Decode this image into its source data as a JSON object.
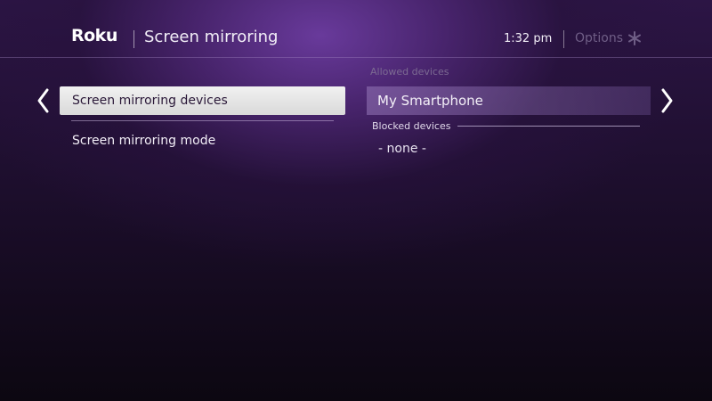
{
  "header": {
    "logo": "Roku",
    "title": "Screen mirroring",
    "time": "1:32  pm",
    "options_label": "Options",
    "options_icon": "asterisk-icon"
  },
  "nav": {
    "left_icon": "chevron-left-icon",
    "right_icon": "chevron-right-icon"
  },
  "menu": {
    "items": [
      {
        "label": "Screen mirroring devices",
        "selected": true
      },
      {
        "label": "Screen mirroring mode",
        "selected": false
      }
    ]
  },
  "devices": {
    "allowed_label": "Allowed devices",
    "allowed": [
      "My Smartphone"
    ],
    "blocked_label": "Blocked devices",
    "blocked_empty": "- none -"
  },
  "colors": {
    "accent_purple": "#6c3ca0",
    "selected_bg": "#e6e6e6",
    "selected_text": "#2a1838",
    "options_muted": "#6f5e86"
  }
}
